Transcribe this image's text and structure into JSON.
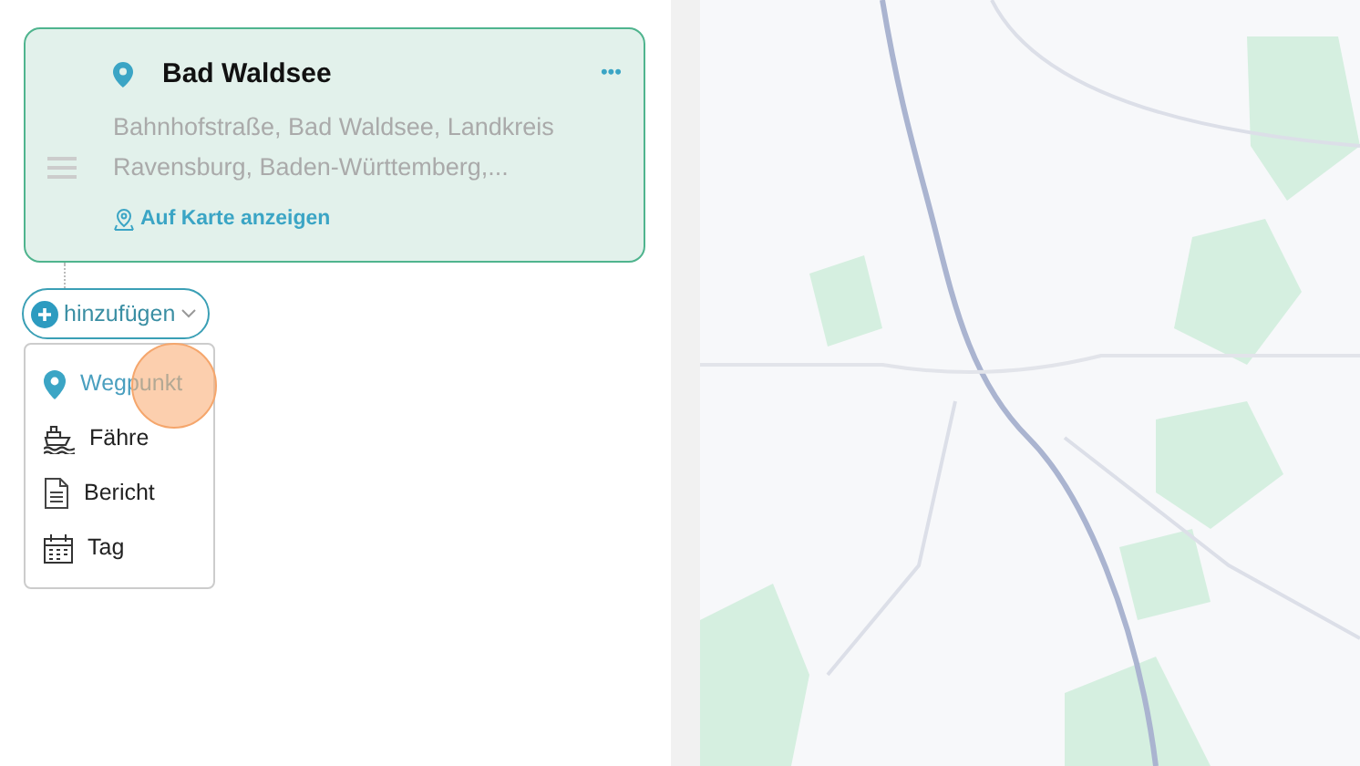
{
  "stop": {
    "title": "Bad Waldsee",
    "address": "Bahnhofstraße, Bad Waldsee, Landkreis Ravensburg, Baden-Württemberg,...",
    "map_link": "Auf Karte anzeigen",
    "more": "•••"
  },
  "add_button": {
    "label": "hinzufügen"
  },
  "menu": [
    {
      "kind": "waypoint",
      "label": "Wegpunkt",
      "selected": true
    },
    {
      "kind": "ferry",
      "label": "Fähre",
      "selected": false
    },
    {
      "kind": "report",
      "label": "Bericht",
      "selected": false
    },
    {
      "kind": "day",
      "label": "Tag",
      "selected": false
    }
  ]
}
